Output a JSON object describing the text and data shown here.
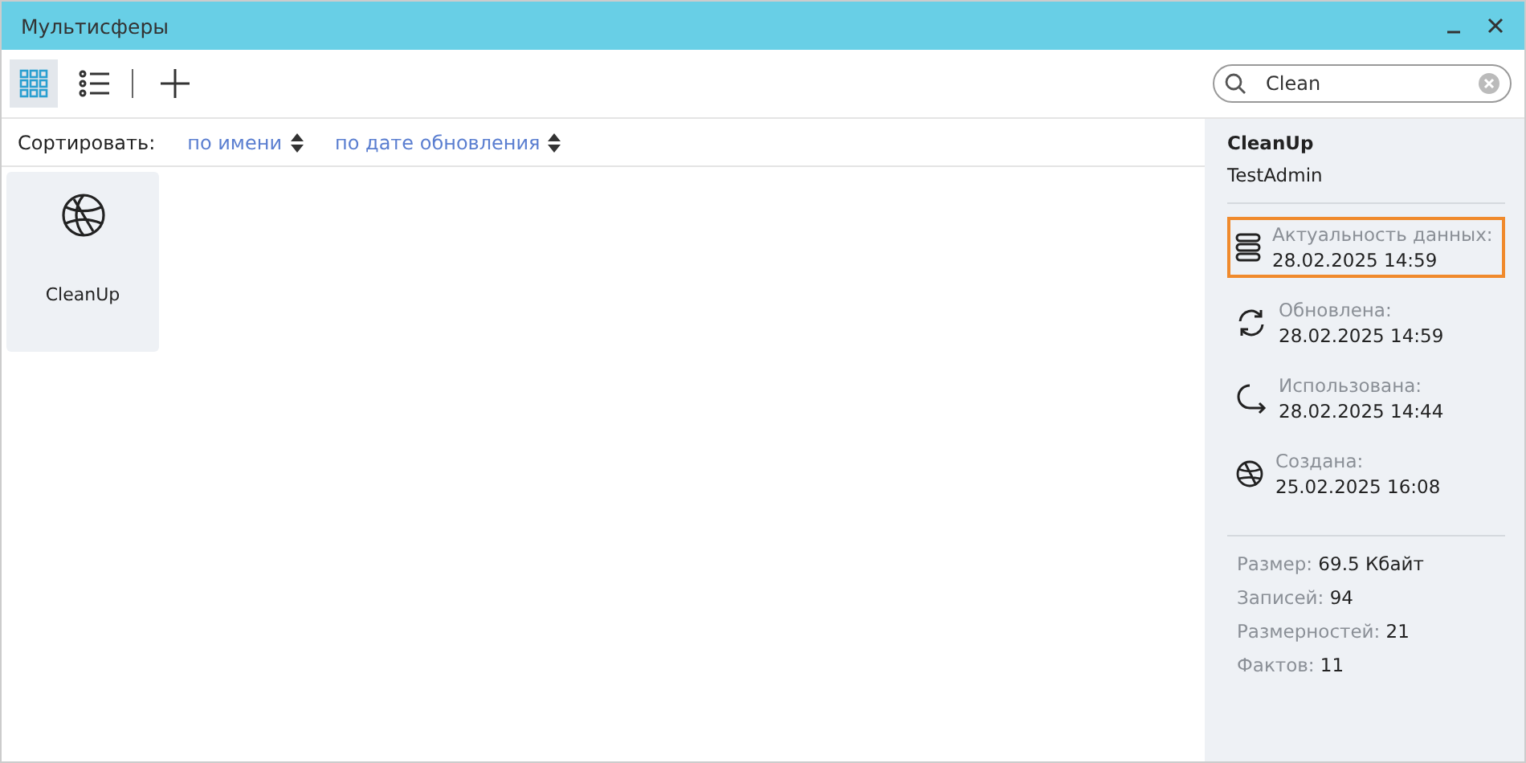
{
  "window": {
    "title": "Мультисферы"
  },
  "toolbar": {
    "views": [
      {
        "kind": "grid",
        "selected": true
      },
      {
        "kind": "list",
        "selected": false
      }
    ]
  },
  "search": {
    "value": "Clean"
  },
  "sort": {
    "label": "Сортировать:",
    "options": [
      {
        "label": "по имени"
      },
      {
        "label": "по дате обновления"
      }
    ]
  },
  "items": [
    {
      "name": "CleanUp",
      "selected": true
    }
  ],
  "details": {
    "name": "CleanUp",
    "owner": "TestAdmin",
    "dates": [
      {
        "kind": "data",
        "label": "Актуальность данных:",
        "value": "28.02.2025 14:59",
        "highlighted": true
      },
      {
        "kind": "updated",
        "label": "Обновлена:",
        "value": "28.02.2025 14:59",
        "highlighted": false
      },
      {
        "kind": "used",
        "label": "Использована:",
        "value": "28.02.2025 14:44",
        "highlighted": false
      },
      {
        "kind": "created",
        "label": "Создана:",
        "value": "25.02.2025 16:08",
        "highlighted": false
      }
    ],
    "stats": [
      {
        "label": "Размер:",
        "value": "69.5 Кбайт"
      },
      {
        "label": "Записей:",
        "value": "94"
      },
      {
        "label": "Размерностей:",
        "value": "21"
      },
      {
        "label": "Фактов:",
        "value": "11"
      }
    ]
  }
}
